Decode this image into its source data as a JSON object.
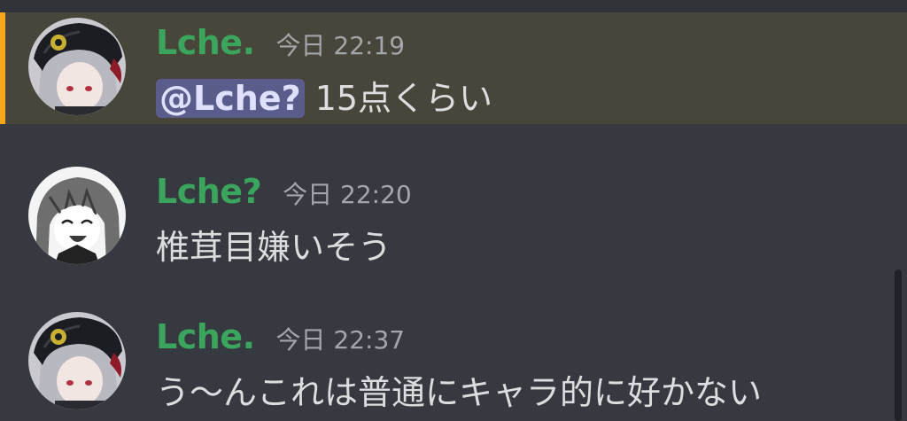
{
  "messages": [
    {
      "username": "Lche.",
      "timestamp": "今日 22:19",
      "mention": "@Lche?",
      "text": "15点くらい",
      "avatar_icon": "armored-helmet-avatar-icon"
    },
    {
      "username": "Lche?",
      "timestamp": "今日 22:20",
      "text": "椎茸目嫌いそう",
      "avatar_icon": "smiling-character-avatar-icon"
    },
    {
      "username": "Lche.",
      "timestamp": "今日 22:37",
      "text": "う〜んこれは普通にキャラ的に好かない",
      "avatar_icon": "armored-helmet-avatar-icon"
    }
  ],
  "colors": {
    "background": "#36393f",
    "mention_highlight": "#48453a",
    "mention_bar": "#faa61a",
    "username": "#3ba55d",
    "mention_pill": "#5a5d8c"
  }
}
